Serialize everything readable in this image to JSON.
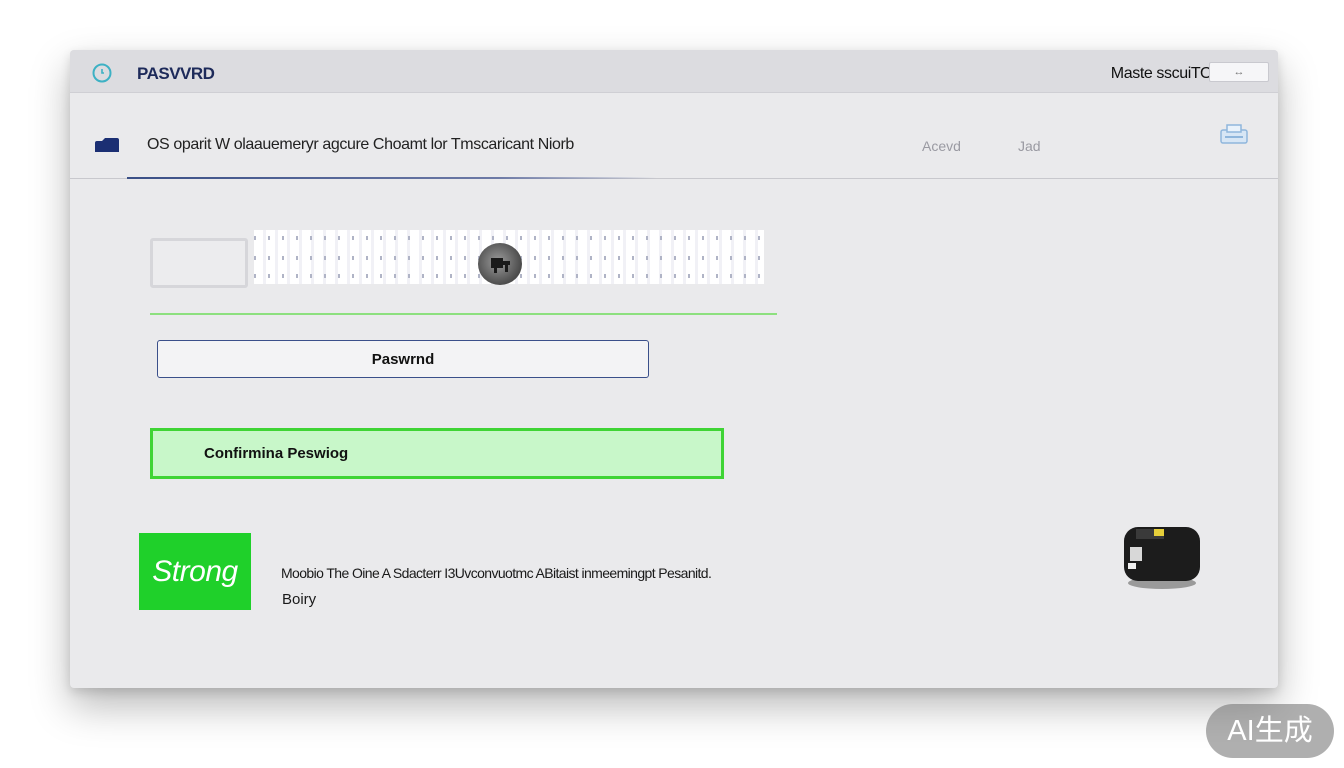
{
  "window": {
    "title": "PASVVRD",
    "title_right": "Maste sscuiTO",
    "control_label": "↔"
  },
  "toolbar": {
    "text": "OS oparit W olaauemeryr agcure Choamt lor Tmscaricant Niorb",
    "buttons": [
      {
        "label": "Acevd"
      },
      {
        "label": "Jad"
      }
    ]
  },
  "form": {
    "password_placeholder": "Paswrnd",
    "confirm_placeholder": "Confirmina Peswiog"
  },
  "strength": {
    "label": "Strong",
    "description": "Moobio The Oine A Sdacterr I3Uvconvuotmc ABitaist inmeemingpt Pesanitd.",
    "description2": "Boiry"
  },
  "badge": {
    "text": "AI生成"
  },
  "colors": {
    "accent_blue": "#1d2a5a",
    "strong_green": "#1fd02a",
    "confirm_border": "#3fd435"
  }
}
